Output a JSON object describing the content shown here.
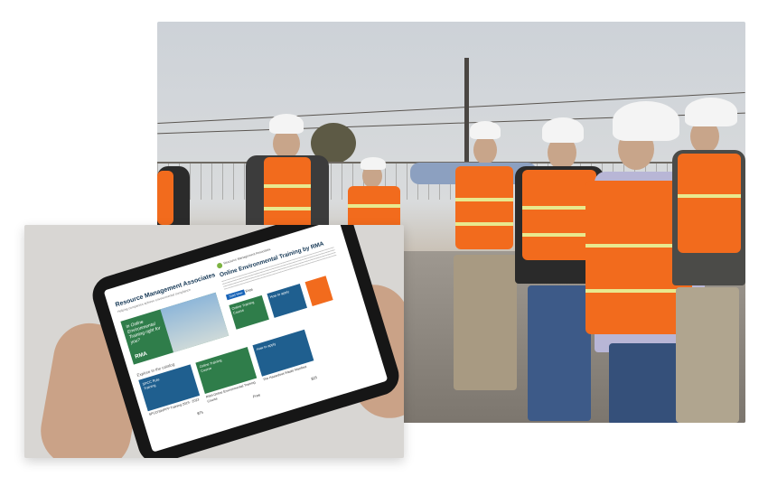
{
  "tablet": {
    "brand": "Resource Management Associates",
    "tagline": "Helping companies achieve environmental compliance",
    "course": {
      "org": "Resource Management Associates",
      "title": "Online Environmental Training by RMA",
      "start_label": "Start Now",
      "price": "Free"
    },
    "hero": {
      "text": "In Online Environmental Training right for you?",
      "logo": "RMA"
    },
    "related": [
      {
        "label": "Online Training Course",
        "color": "#2f7d4a"
      },
      {
        "label": "How to apply",
        "color": "#1f5f8f"
      }
    ],
    "catalog_label": "Explore in the catalog",
    "cards": [
      {
        "image_text": "SPCC Rule Training",
        "text": "SPCC/SWPPP Training 2019 - 2023",
        "price": "$75",
        "color": "#1f5f8f"
      },
      {
        "image_text": "Online Training Course",
        "text": "RMA Online Environmental Training Course",
        "price": "Free",
        "color": "#2f7d4a"
      },
      {
        "image_text": "How to apply",
        "text": "The Hazardous Waste Manifest",
        "price": "$25",
        "color": "#1f5f8f"
      }
    ]
  }
}
